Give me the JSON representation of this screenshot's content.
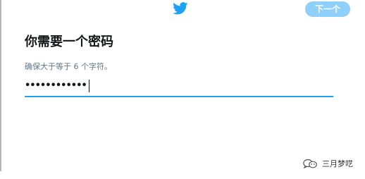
{
  "header": {
    "logo_icon": "twitter-bird-icon",
    "next_label": "下一个",
    "brand_color": "#1da1f2",
    "next_button_color": "#8ed0f9"
  },
  "form": {
    "title": "你需要一个密码",
    "hint": "确保大于等于 6 个字符。",
    "password_value": "••••••••••••",
    "underline_color": "#1da1f2"
  },
  "watermark": {
    "icon": "wechat-icon",
    "text": "三月梦呓"
  }
}
